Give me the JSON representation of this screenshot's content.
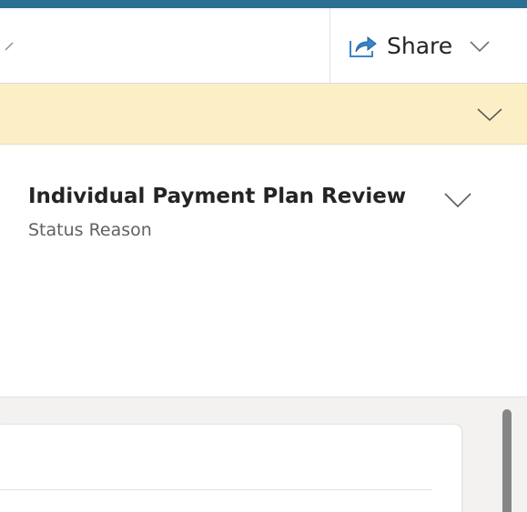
{
  "toolbar": {
    "share_label": "Share",
    "icons": {
      "share": "share-icon",
      "share_menu": "chevron-down-icon",
      "overflow": "chevron-down-icon"
    }
  },
  "banner": {
    "background_color": "#fcefc6",
    "icon": "chevron-down-icon"
  },
  "header_field": {
    "value": "Individual Payment Plan Review",
    "label": "Status Reason",
    "icon": "chevron-down-icon"
  },
  "colors": {
    "accent": "#2b6f92",
    "text_primary": "#242424",
    "text_secondary": "#616161",
    "share_icon": "#3a86c8"
  }
}
